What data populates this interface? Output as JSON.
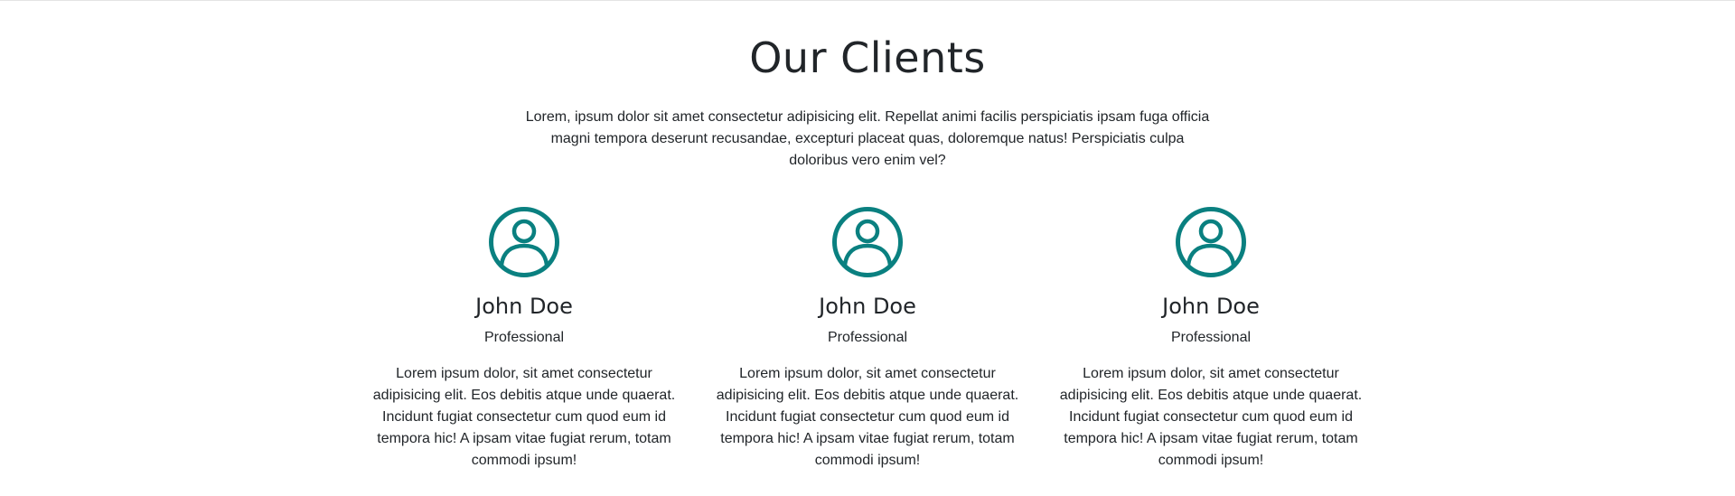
{
  "section": {
    "title": "Our Clients",
    "intro": "Lorem, ipsum dolor sit amet consectetur adipisicing elit. Repellat animi facilis perspiciatis ipsam fuga officia magni tempora deserunt recusandae, excepturi placeat quas, doloremque natus! Perspiciatis culpa doloribus vero enim vel?"
  },
  "colors": {
    "accent": "#0a8080",
    "text": "#212529"
  },
  "clients": [
    {
      "icon": "person-circle-icon",
      "name": "John Doe",
      "role": "Professional",
      "text": "Lorem ipsum dolor, sit amet consectetur adipisicing elit. Eos debitis atque unde quaerat. Incidunt fugiat consectetur cum quod eum id tempora hic! A ipsam vitae fugiat rerum, totam commodi ipsum!"
    },
    {
      "icon": "person-circle-icon",
      "name": "John Doe",
      "role": "Professional",
      "text": "Lorem ipsum dolor, sit amet consectetur adipisicing elit. Eos debitis atque unde quaerat. Incidunt fugiat consectetur cum quod eum id tempora hic! A ipsam vitae fugiat rerum, totam commodi ipsum!"
    },
    {
      "icon": "person-circle-icon",
      "name": "John Doe",
      "role": "Professional",
      "text": "Lorem ipsum dolor, sit amet consectetur adipisicing elit. Eos debitis atque unde quaerat. Incidunt fugiat consectetur cum quod eum id tempora hic! A ipsam vitae fugiat rerum, totam commodi ipsum!"
    }
  ]
}
